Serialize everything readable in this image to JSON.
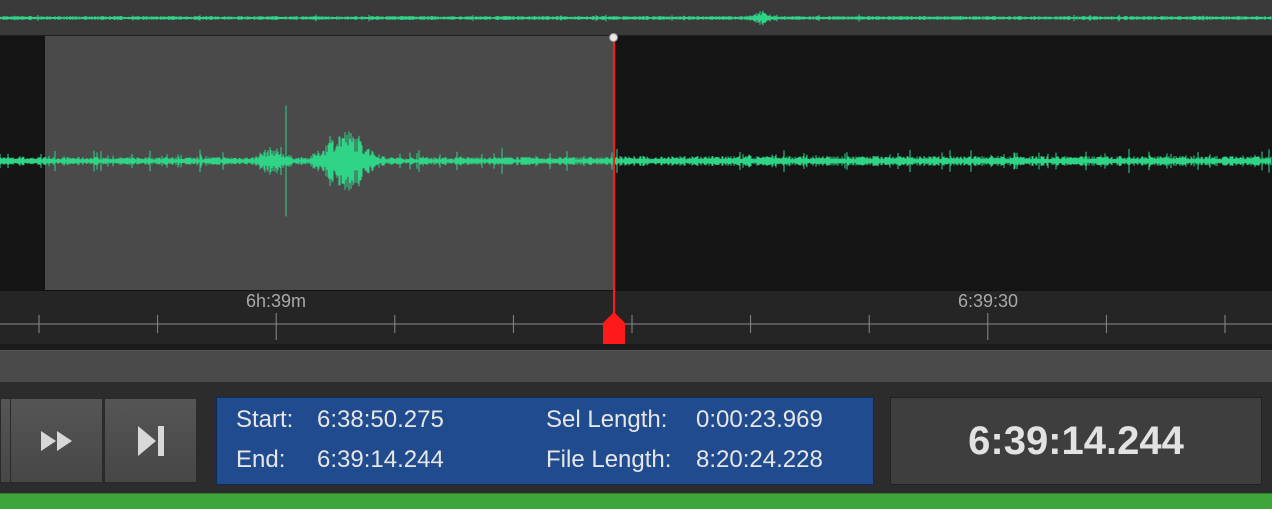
{
  "ruler": {
    "labels": [
      "6h:39m",
      "6:39:30"
    ]
  },
  "transport": {
    "fast_forward_icon": "fast-forward-icon",
    "skip_end_icon": "skip-to-end-icon"
  },
  "selection_info": {
    "start_label": "Start:",
    "start_value": "6:38:50.275",
    "end_label": "End:",
    "end_value": "6:39:14.244",
    "sel_length_label": "Sel Length:",
    "sel_length_value": "0:00:23.969",
    "file_length_label": "File Length:",
    "file_length_value": "8:20:24.228"
  },
  "current_time": "6:39:14.244",
  "colors": {
    "waveform": "#2fd487",
    "playhead": "#ff1a1a",
    "info_panel": "#204b8e",
    "status_bar": "#3fa53a"
  }
}
